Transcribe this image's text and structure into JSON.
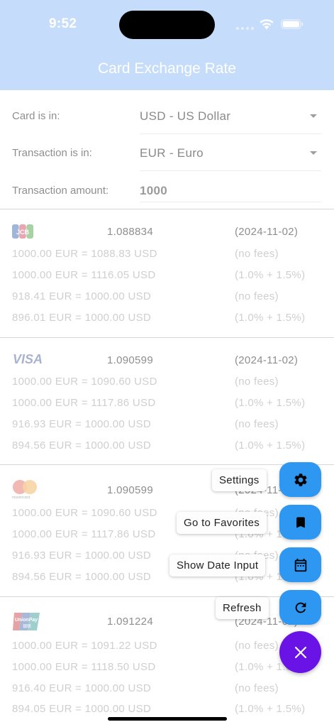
{
  "status_bar": {
    "time": "9:52"
  },
  "header": {
    "title": "Card Exchange Rate"
  },
  "form": {
    "card_label": "Card is in:",
    "card_value": "USD - US Dollar",
    "transaction_label": "Transaction is in:",
    "transaction_value": "EUR - Euro",
    "amount_label": "Transaction amount:",
    "amount_value": "1000"
  },
  "cards": [
    {
      "brand": "JCB",
      "logo_text": "JCB",
      "rate": "1.088834",
      "date": "(2024-11-02)",
      "rows": [
        {
          "calc": "1000.00 EUR = 1088.83 USD",
          "fee": "(no fees)"
        },
        {
          "calc": "1000.00 EUR = 1116.05 USD",
          "fee": "(1.0% + 1.5%)"
        },
        {
          "calc": "918.41 EUR = 1000.00 USD",
          "fee": "(no fees)"
        },
        {
          "calc": "896.01 EUR = 1000.00 USD",
          "fee": "(1.0% + 1.5%)"
        }
      ]
    },
    {
      "brand": "Visa",
      "logo_text": "VISA",
      "rate": "1.090599",
      "date": "(2024-11-02)",
      "rows": [
        {
          "calc": "1000.00 EUR = 1090.60 USD",
          "fee": "(no fees)"
        },
        {
          "calc": "1000.00 EUR = 1117.86 USD",
          "fee": "(1.0% + 1.5%)"
        },
        {
          "calc": "916.93 EUR = 1000.00 USD",
          "fee": "(no fees)"
        },
        {
          "calc": "894.56 EUR = 1000.00 USD",
          "fee": "(1.0% + 1.5%)"
        }
      ]
    },
    {
      "brand": "Mastercard",
      "logo_text": "mastercard",
      "rate": "1.090599",
      "date": "(2024-11-02)",
      "rows": [
        {
          "calc": "1000.00 EUR = 1090.60 USD",
          "fee": "(no fees)"
        },
        {
          "calc": "1000.00 EUR = 1117.86 USD",
          "fee": "(1.0% + 1.5%)"
        },
        {
          "calc": "916.93 EUR = 1000.00 USD",
          "fee": "(no fees)"
        },
        {
          "calc": "894.56 EUR = 1000.00 USD",
          "fee": "(1.0% + 1.5%)"
        }
      ]
    },
    {
      "brand": "UnionPay",
      "logo_text": "UnionPay",
      "logo_text_cn": "银联",
      "rate": "1.091224",
      "date": "(2024-11-02)",
      "rows": [
        {
          "calc": "1000.00 EUR = 1091.22 USD",
          "fee": "(no fees)"
        },
        {
          "calc": "1000.00 EUR = 1118.50 USD",
          "fee": "(1.0% + 1.5%)"
        },
        {
          "calc": "916.40 EUR = 1000.00 USD",
          "fee": "(no fees)"
        },
        {
          "calc": "894.05 EUR = 1000.00 USD",
          "fee": "(1.0% + 1.5%)"
        }
      ]
    }
  ],
  "fab_menu": {
    "items": [
      {
        "label": "Settings",
        "icon": "gear-icon"
      },
      {
        "label": "Go to Favorites",
        "icon": "bookmark-icon"
      },
      {
        "label": "Show Date Input",
        "icon": "calendar-icon"
      },
      {
        "label": "Refresh",
        "icon": "refresh-icon"
      }
    ],
    "main_icon": "close-icon"
  },
  "colors": {
    "header_bg": "#c6dcfb",
    "fab_mini": "#2d97f2",
    "fab_main": "#6a13e6",
    "muted_text": "#cfcfcf"
  }
}
